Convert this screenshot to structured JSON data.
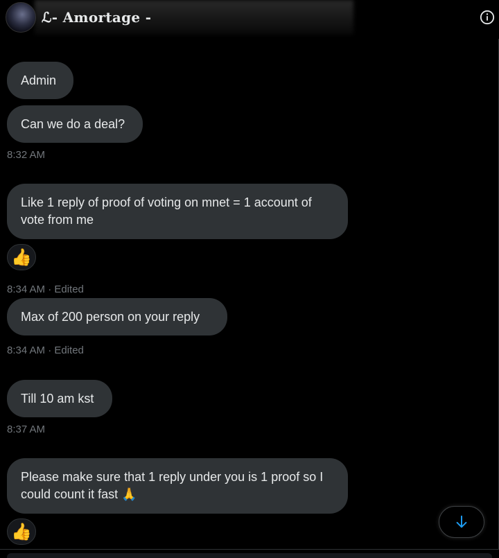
{
  "header": {
    "title": "ℒ- Amortage -"
  },
  "messages": [
    {
      "text": "Admin"
    },
    {
      "text": "Can we do a deal?"
    },
    {
      "text": "Like 1 reply of proof of voting on mnet = 1 account of vote from me"
    },
    {
      "text": "Max of 200 person on your reply"
    },
    {
      "text": "Till 10 am kst"
    },
    {
      "text": "Please make sure that 1 reply under you is 1 proof so I could count it fast 🙏"
    }
  ],
  "timestamps": [
    {
      "text": "8:32 AM"
    },
    {
      "text": "8:34 AM · Edited"
    },
    {
      "text": "8:34 AM · Edited"
    },
    {
      "text": "8:37 AM"
    }
  ],
  "reactions": [
    {
      "emoji": "👍"
    },
    {
      "emoji": "👍"
    }
  ],
  "icons": {
    "info": "info-icon",
    "scroll_down": "arrow-down-icon"
  },
  "colors": {
    "background": "#000000",
    "bubble": "#2f3336",
    "text": "#e7e9ea",
    "muted": "#71767b",
    "accent": "#1d9bf0"
  }
}
